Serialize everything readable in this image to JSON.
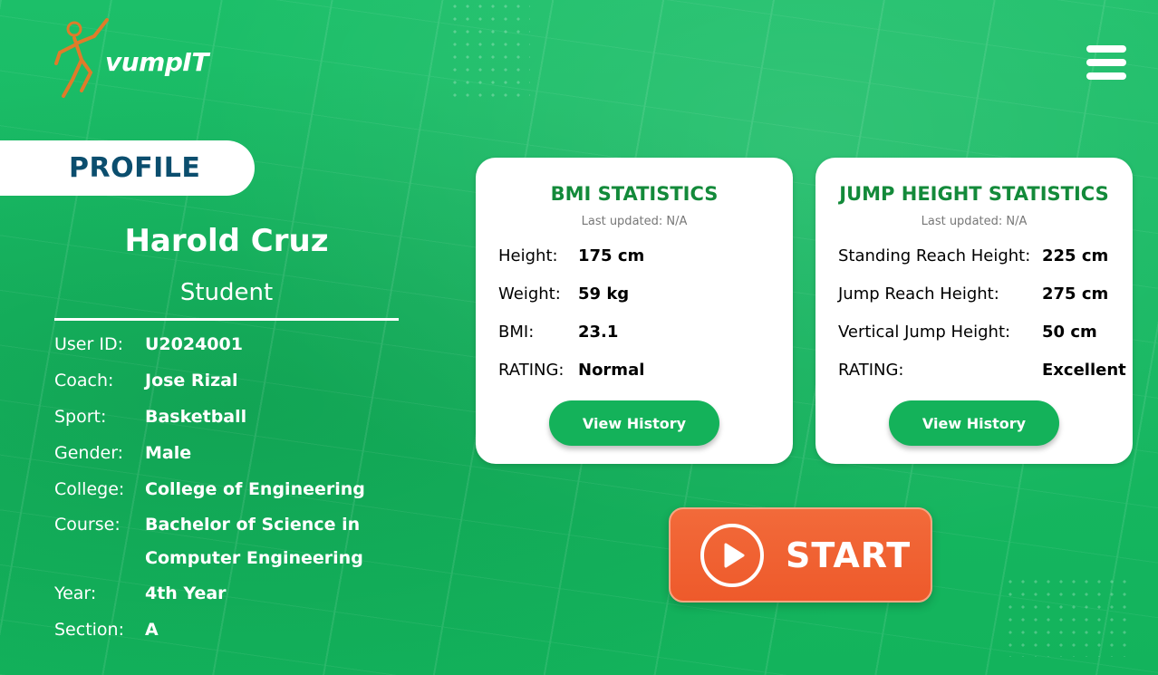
{
  "app": {
    "logo_text": "vumpIT",
    "menu_icon": "hamburger-menu-icon"
  },
  "profile": {
    "tab_label": "PROFILE",
    "name": "Harold Cruz",
    "role": "Student",
    "fields": [
      {
        "label": "User ID:",
        "value": "U2024001"
      },
      {
        "label": "Coach:",
        "value": "Jose Rizal"
      },
      {
        "label": "Sport:",
        "value": "Basketball"
      },
      {
        "label": "Gender:",
        "value": "Male"
      },
      {
        "label": "College:",
        "value": "College of Engineering"
      },
      {
        "label": "Course:",
        "value": "Bachelor of Science in",
        "value2": "Computer Engineering"
      },
      {
        "label": "Year:",
        "value": "4th Year"
      },
      {
        "label": "Section:",
        "value": "A"
      }
    ]
  },
  "bmi": {
    "title": "BMI STATISTICS",
    "updated": "Last updated: N/A",
    "rows": [
      {
        "label": "Height:",
        "value": "175 cm"
      },
      {
        "label": "Weight:",
        "value": "59 kg"
      },
      {
        "label": "BMI:",
        "value": "23.1"
      },
      {
        "label": "RATING:",
        "value": "Normal"
      }
    ],
    "button": "View History"
  },
  "jump": {
    "title": "JUMP HEIGHT STATISTICS",
    "updated": "Last updated: N/A",
    "rows": [
      {
        "label": "Standing Reach Height:",
        "value": "225 cm"
      },
      {
        "label": "Jump Reach Height:",
        "value": "275 cm"
      },
      {
        "label": "Vertical Jump Height:",
        "value": "50 cm"
      },
      {
        "label": "RATING:",
        "value": "Excellent"
      }
    ],
    "button": "View History"
  },
  "start": {
    "label": "START",
    "icon": "play-icon"
  },
  "colors": {
    "background": "#17b862",
    "title_green": "#138a3a",
    "button_green": "#14b25a",
    "profile_navy": "#0b4e6e",
    "start_orange": "#ee5a2b"
  }
}
